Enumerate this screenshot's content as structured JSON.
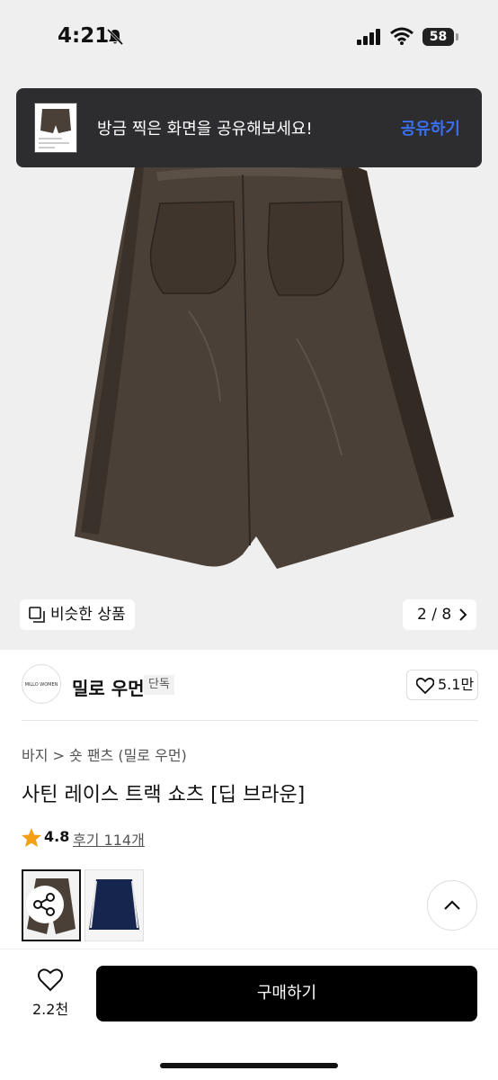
{
  "status_bar": {
    "time": "4:21",
    "battery": "58"
  },
  "toast": {
    "message": "방금 찍은 화면을 공유해보세요!",
    "action": "공유하기"
  },
  "gallery": {
    "similar_label": "비슷한 상품",
    "pager": "2 / 8"
  },
  "brand": {
    "logo_text": "MILLO WOMEN",
    "name": "밀로 우먼",
    "badge": "단독",
    "likes": "5.1만"
  },
  "product": {
    "breadcrumb": "바지 > 숏 팬츠 (밀로 우먼)",
    "title": "사틴 레이스 트랙 쇼츠 [딥 브라운]",
    "rating": "4.8",
    "review_link": "후기 114개"
  },
  "bottom_bar": {
    "wish_count": "2.2천",
    "buy_label": "구매하기"
  },
  "colors": {
    "accent": "#3a6ff0",
    "star": "#f4a016",
    "product_brown": "#4a3f35"
  },
  "icons": [
    "bell-slash-icon",
    "signal-icon",
    "wifi-icon",
    "similar-icon",
    "chevron-right-icon",
    "heart-icon",
    "star-icon",
    "share-icon",
    "chevron-up-icon"
  ]
}
